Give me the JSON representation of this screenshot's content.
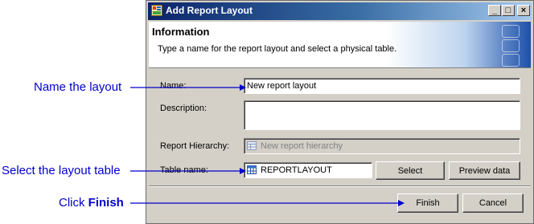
{
  "window": {
    "title": "Add Report Layout",
    "controls": {
      "minimize": "_",
      "maximize": "□",
      "close": "×"
    }
  },
  "header": {
    "heading": "Information",
    "description": "Type a name for the report layout and select a physical table."
  },
  "form": {
    "name_label": "Name:",
    "name_value": "New report layout",
    "description_label": "Description:",
    "description_value": "",
    "hierarchy_label": "Report Hierarchy:",
    "hierarchy_value": "New report hierarchy",
    "table_label": "Table name:",
    "table_value": "REPORTLAYOUT",
    "select_label": "Select",
    "preview_label": "Preview data"
  },
  "footer": {
    "finish_label": "Finish",
    "cancel_label": "Cancel"
  },
  "annotations": {
    "name_layout": "Name the layout",
    "select_table": "Select the layout table",
    "click_prefix": "Click ",
    "click_bold": "Finish"
  },
  "colors": {
    "annotation": "#0000cc",
    "title_bar": "#0a246a",
    "dialog_bg": "#d4d0c8"
  },
  "icons": [
    "app-icon",
    "hierarchy-icon",
    "table-icon"
  ]
}
